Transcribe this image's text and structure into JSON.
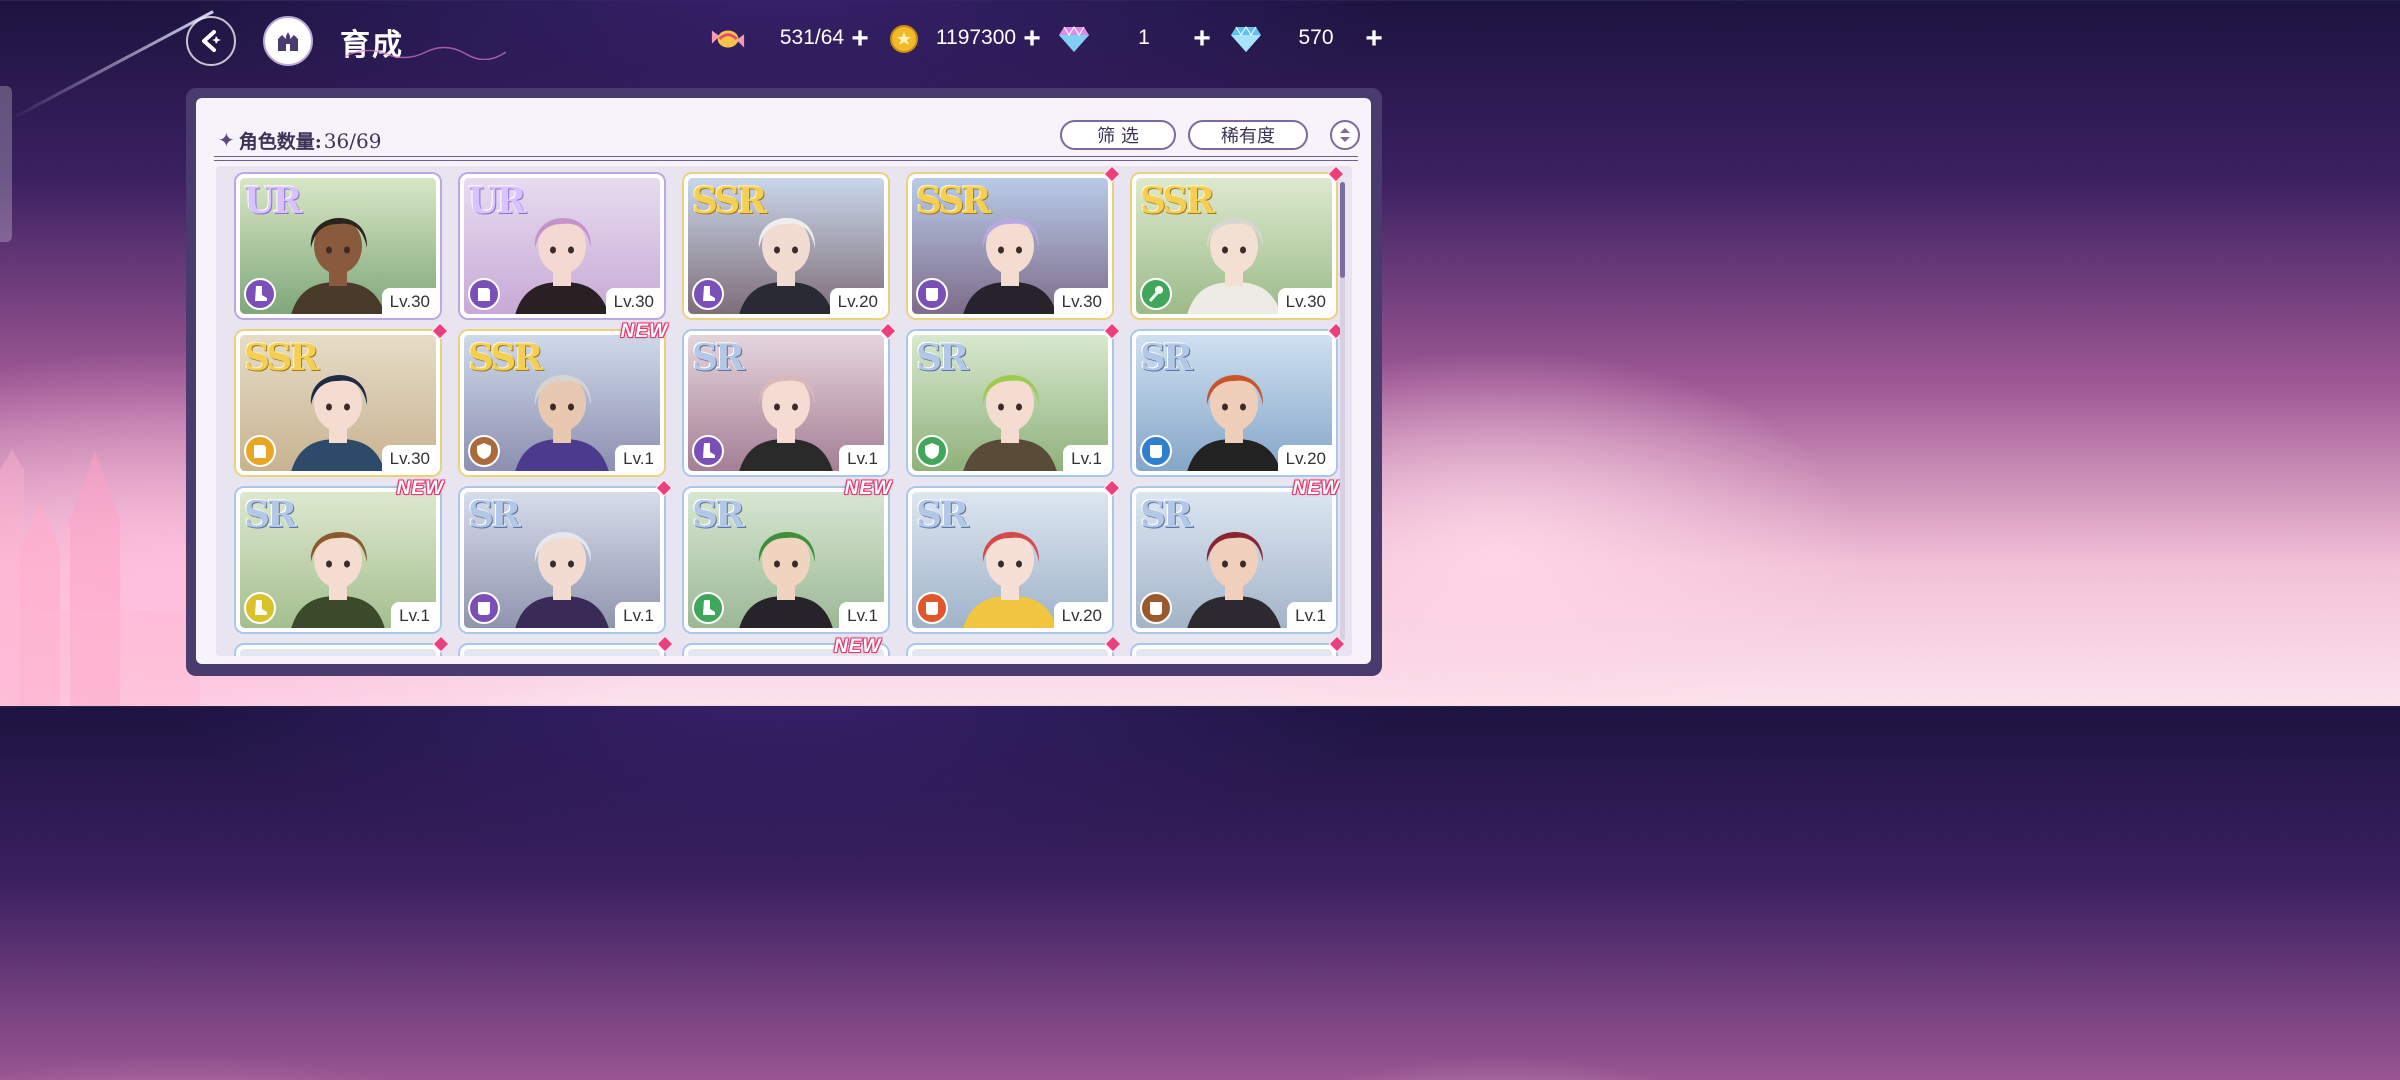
{
  "header": {
    "title": "育成",
    "resources": [
      {
        "icon": "candy-icon",
        "value": "531/64"
      },
      {
        "icon": "gold-coin-icon",
        "value": "1197300"
      },
      {
        "icon": "pink-gem-icon",
        "value": "1"
      },
      {
        "icon": "blue-gem-icon",
        "value": "570"
      }
    ]
  },
  "panel": {
    "count_label": "角色数量:",
    "count_value": "36/69",
    "filter_label": "筛 选",
    "rarity_label": "稀有度"
  },
  "cards": [
    {
      "rarity": "UR",
      "level": "Lv.30",
      "class_color": "#7a4fb8",
      "bg": [
        "#d8e7c6",
        "#7fa77a"
      ],
      "hair": "#2a2320",
      "skin": "#8a5a3c",
      "outfit": "#4a3a2a",
      "marker": "none"
    },
    {
      "rarity": "UR",
      "level": "Lv.30",
      "class_color": "#7a4fb8",
      "bg": [
        "#e6dcef",
        "#c8a9d6"
      ],
      "hair": "#c592c9",
      "skin": "#f4d8d2",
      "outfit": "#2a2024",
      "marker": "none"
    },
    {
      "rarity": "SSR",
      "level": "Lv.20",
      "class_color": "#7a4fb8",
      "bg": [
        "#c9d6ea",
        "#7e6e78"
      ],
      "hair": "#eeeeee",
      "skin": "#f2dcd2",
      "outfit": "#2a2a34",
      "marker": "none"
    },
    {
      "rarity": "SSR",
      "level": "Lv.30",
      "class_color": "#7a4fb8",
      "bg": [
        "#b8cbe8",
        "#7d6c8a"
      ],
      "hair": "#b6a8e0",
      "skin": "#f4dcd0",
      "outfit": "#26232c",
      "marker": "diamond"
    },
    {
      "rarity": "SSR",
      "level": "Lv.30",
      "class_color": "#3fa65a",
      "bg": [
        "#dde9cf",
        "#9bbb88"
      ],
      "hair": "#d8d6d0",
      "skin": "#f4e0d2",
      "outfit": "#ecebe6",
      "marker": "diamond"
    },
    {
      "rarity": "SSR",
      "level": "Lv.30",
      "class_color": "#e8a624",
      "bg": [
        "#e6dcc6",
        "#c7b391"
      ],
      "hair": "#1f2a44",
      "skin": "#f4dcd0",
      "outfit": "#2d4a6a",
      "marker": "diamond"
    },
    {
      "rarity": "SSR",
      "level": "Lv.1",
      "class_color": "#a96b3c",
      "bg": [
        "#cfd9ea",
        "#8c8fb0"
      ],
      "hair": "#d4d4d4",
      "skin": "#e8c8b0",
      "outfit": "#4b3a8e",
      "marker": "new"
    },
    {
      "rarity": "SR",
      "level": "Lv.1",
      "class_color": "#7a4fb8",
      "bg": [
        "#e5d4dc",
        "#a47f95"
      ],
      "hair": "#d9b8b8",
      "skin": "#f4dcd2",
      "outfit": "#2a2a2a",
      "marker": "diamond"
    },
    {
      "rarity": "SR",
      "level": "Lv.1",
      "class_color": "#3fa65a",
      "bg": [
        "#d8e8cf",
        "#8fb17a"
      ],
      "hair": "#9ecb4f",
      "skin": "#f4dcd0",
      "outfit": "#5a4a38",
      "marker": "diamond"
    },
    {
      "rarity": "SR",
      "level": "Lv.20",
      "class_color": "#2f7fd0",
      "bg": [
        "#cfe0f0",
        "#84a6c9"
      ],
      "hair": "#c8552a",
      "skin": "#f0cfba",
      "outfit": "#222222",
      "marker": "diamond"
    },
    {
      "rarity": "SR",
      "level": "Lv.1",
      "class_color": "#d9c32a",
      "bg": [
        "#dde8cf",
        "#a4bf8f"
      ],
      "hair": "#8a5a2c",
      "skin": "#f4dcd0",
      "outfit": "#3b4a2a",
      "marker": "new"
    },
    {
      "rarity": "SR",
      "level": "Lv.1",
      "class_color": "#7a4fb8",
      "bg": [
        "#d6dcea",
        "#8f95ae"
      ],
      "hair": "#e6e6ee",
      "skin": "#f2dcd2",
      "outfit": "#3a2a58",
      "marker": "diamond"
    },
    {
      "rarity": "SR",
      "level": "Lv.1",
      "class_color": "#3fa65a",
      "bg": [
        "#d7e6d2",
        "#9cb896"
      ],
      "hair": "#3f8f3a",
      "skin": "#f0d4c0",
      "outfit": "#27232a",
      "marker": "new"
    },
    {
      "rarity": "SR",
      "level": "Lv.20",
      "class_color": "#e0582a",
      "bg": [
        "#dde6f0",
        "#9fb3c9"
      ],
      "hair": "#d6484c",
      "skin": "#f6e0d6",
      "outfit": "#f2c640",
      "marker": "diamond"
    },
    {
      "rarity": "SR",
      "level": "Lv.1",
      "class_color": "#9a5a2e",
      "bg": [
        "#dce6f2",
        "#a3b4c8"
      ],
      "hair": "#8a2430",
      "skin": "#f0d0bc",
      "outfit": "#2c2a30",
      "marker": "new"
    }
  ],
  "partial_row_markers": [
    "diamond",
    "diamond",
    "new",
    "diamond",
    "diamond"
  ],
  "partial_row_new_text": "NEW"
}
